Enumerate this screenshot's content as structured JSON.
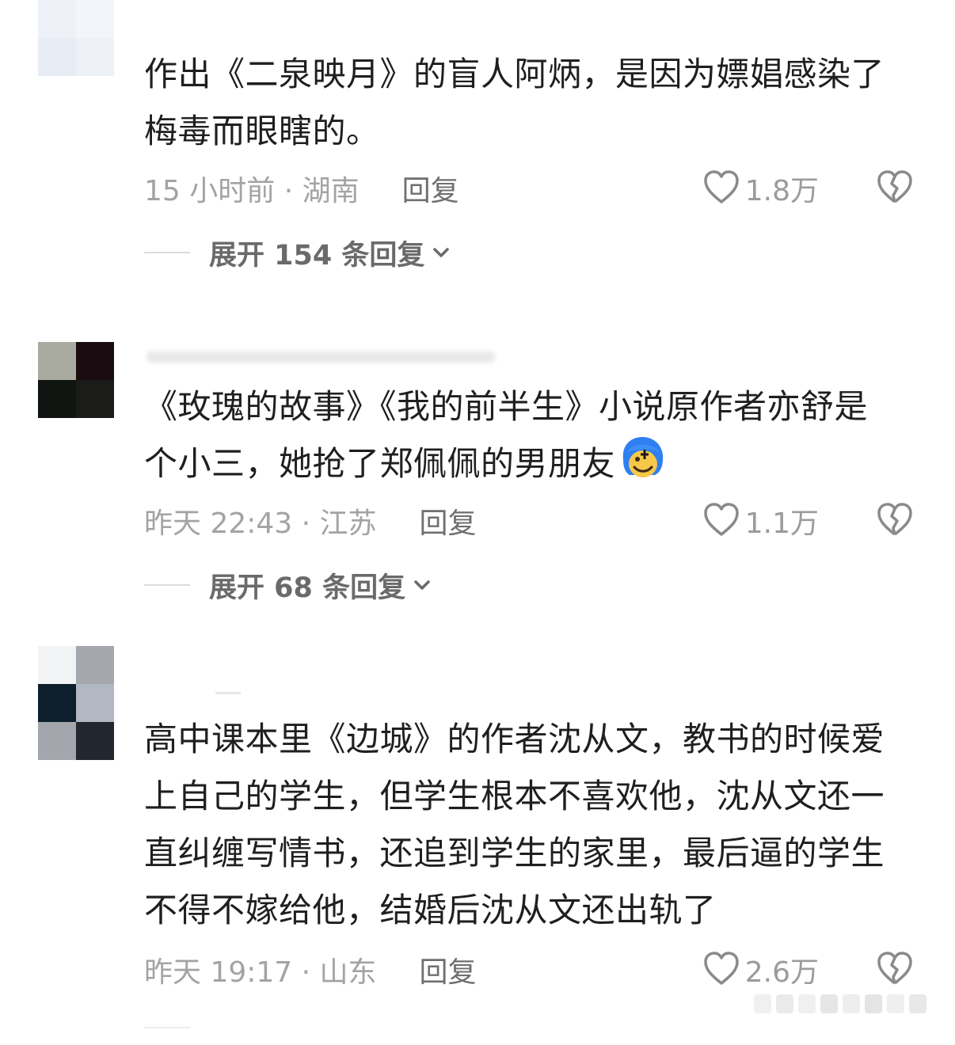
{
  "comments": [
    {
      "username": "",
      "text_lines": [
        "作出《二泉映月》的盲人阿炳，是因为嫖娼感染了",
        "梅毒而眼瞎的。"
      ],
      "time_location": "15 小时前 · 湖南",
      "reply_label": "回复",
      "likes": "1.8万",
      "expand_label": "展开 154 条回复"
    },
    {
      "username": "",
      "text_lines": [
        "《玫瑰的故事》《我的前半生》小说原作者亦舒是",
        "个小三，她抢了郑佩佩的男朋友"
      ],
      "emoji": "blushing-face-emoji",
      "time_location": "昨天 22:43 · 江苏",
      "reply_label": "回复",
      "likes": "1.1万",
      "expand_label": "展开 68 条回复"
    },
    {
      "username": "",
      "text_lines": [
        "高中课本里《边城》的作者沈从文，教书的时候爱",
        "上自己的学生，但学生根本不喜欢他，沈从文还一",
        "直纠缠写情书，还追到学生的家里，最后逼的学生",
        "不得不嫁给他，结婚后沈从文还出轨了"
      ],
      "time_location": "昨天 19:17 · 山东",
      "reply_label": "回复",
      "likes": "2.6万",
      "expand_label": ""
    }
  ],
  "icons": {
    "like": "heart-outline-icon",
    "dislike": "broken-heart-icon",
    "expand": "chevron-down-icon"
  },
  "colors": {
    "text": "#1f1f1f",
    "meta": "#a3a3a3",
    "reply": "#6f6f6f",
    "icon": "#8a8a8a"
  }
}
